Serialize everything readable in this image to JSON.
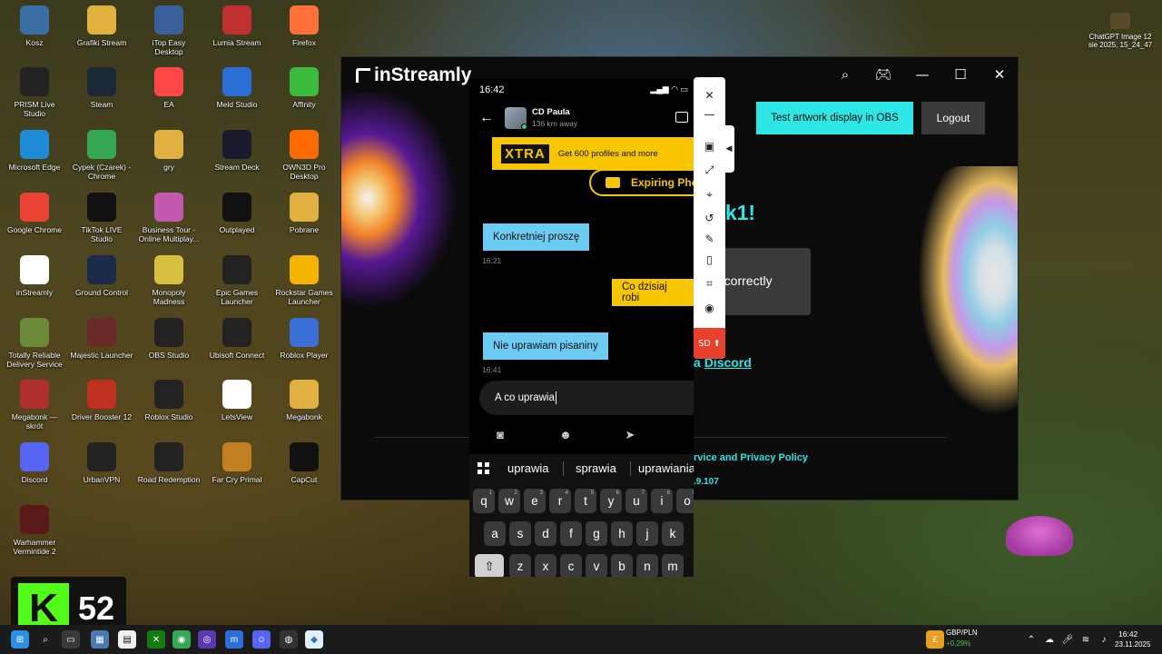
{
  "desktop_icons": [
    {
      "label": "Kosz",
      "icon": "recycle-bin-icon",
      "color": "#3a6ea5"
    },
    {
      "label": "Grafiki Stream",
      "icon": "folder-icon",
      "color": "#e0b040"
    },
    {
      "label": "iTop Easy Desktop",
      "icon": "grid-icon",
      "color": "#3a5f9a"
    },
    {
      "label": "Lumia Stream",
      "icon": "lumia-icon",
      "color": "#c03030"
    },
    {
      "label": "Firefox",
      "icon": "firefox-icon",
      "color": "#ff7139"
    },
    {
      "label": "PRISM Live Studio",
      "icon": "prism-icon",
      "color": "#222222"
    },
    {
      "label": "Steam",
      "icon": "steam-icon",
      "color": "#1b2838"
    },
    {
      "label": "EA",
      "icon": "ea-icon",
      "color": "#ff4747"
    },
    {
      "label": "Meld Studio",
      "icon": "meld-icon",
      "color": "#2b6fd6"
    },
    {
      "label": "Affinity",
      "icon": "affinity-icon",
      "color": "#3dbb3d"
    },
    {
      "label": "Microsoft Edge",
      "icon": "edge-icon",
      "color": "#1f8ad6"
    },
    {
      "label": "Cypek (Czarek) - Chrome",
      "icon": "chrome-icon",
      "color": "#34a853"
    },
    {
      "label": "gry",
      "icon": "folder-icon",
      "color": "#e0b040"
    },
    {
      "label": "Stream Deck",
      "icon": "stream-deck-icon",
      "color": "#1a1a2e"
    },
    {
      "label": "OWN3D Pro Desktop",
      "icon": "own3d-icon",
      "color": "#ff6a00"
    },
    {
      "label": "Google Chrome",
      "icon": "chrome-icon",
      "color": "#ea4335"
    },
    {
      "label": "TikTok LIVE Studio",
      "icon": "tiktok-icon",
      "color": "#111111"
    },
    {
      "label": "Business Tour - Online Multiplay...",
      "icon": "game-icon",
      "color": "#c45ab0"
    },
    {
      "label": "Outplayed",
      "icon": "outplayed-icon",
      "color": "#111111"
    },
    {
      "label": "Pobrane",
      "icon": "folder-icon",
      "color": "#e0b040"
    },
    {
      "label": "inStreamly",
      "icon": "instreamly-icon",
      "color": "#ffffff"
    },
    {
      "label": "Ground Control",
      "icon": "ground-control-icon",
      "color": "#1a2a4a"
    },
    {
      "label": "Monopoly Madness",
      "icon": "game-icon",
      "color": "#d8c040"
    },
    {
      "label": "Epic Games Launcher",
      "icon": "epic-icon",
      "color": "#222222"
    },
    {
      "label": "Rockstar Games Launcher",
      "icon": "rockstar-icon",
      "color": "#f4b400"
    },
    {
      "label": "Totally Reliable Delivery Service",
      "icon": "game-icon",
      "color": "#6a8a3a"
    },
    {
      "label": "Majestic Launcher",
      "icon": "majestic-icon",
      "color": "#6a2a2a"
    },
    {
      "label": "OBS Studio",
      "icon": "obs-icon",
      "color": "#222222"
    },
    {
      "label": "Ubisoft Connect",
      "icon": "ubisoft-icon",
      "color": "#222222"
    },
    {
      "label": "Roblox Player",
      "icon": "roblox-icon",
      "color": "#3a6fd8"
    },
    {
      "label": "Megabonk — skrót",
      "icon": "megabonk-icon",
      "color": "#b03030"
    },
    {
      "label": "Driver Booster 12",
      "icon": "driver-booster-icon",
      "color": "#c03020"
    },
    {
      "label": "Roblox Studio",
      "icon": "roblox-icon",
      "color": "#222222"
    },
    {
      "label": "LetsView",
      "icon": "letsview-icon",
      "color": "#ffffff"
    },
    {
      "label": "Megabonk",
      "icon": "folder-icon",
      "color": "#e0b040"
    },
    {
      "label": "Discord",
      "icon": "discord-icon",
      "color": "#5865f2"
    },
    {
      "label": "UrbanVPN",
      "icon": "vpn-icon",
      "color": "#222222"
    },
    {
      "label": "Road Redemption",
      "icon": "game-icon",
      "color": "#222222"
    },
    {
      "label": "Far Cry Primal",
      "icon": "game-icon",
      "color": "#c08020"
    },
    {
      "label": "CapCut",
      "icon": "capcut-icon",
      "color": "#111111"
    },
    {
      "label": "Warhammer Vermintide 2",
      "icon": "warhammer-icon",
      "color": "#5a1a1a"
    }
  ],
  "top_right_file": {
    "label": "ChatGPT Image 12 sie 2025, 15_24_47"
  },
  "window": {
    "title": "inStreamly",
    "test_button": "Test artwork display in OBS",
    "logout_button": "Logout",
    "greeting_fragment": "pek1!",
    "status_fragment": "g correctly",
    "discord_prefix": "a ",
    "discord_link": "Discord",
    "terms_fragment": "rvice and Privacy Policy",
    "version_fragment": ".9.107",
    "accent": "#2de6e6"
  },
  "phone": {
    "time": "16:42",
    "status_icons": "▂▄▆ ◠ ▭",
    "contact_name": "CD Paula",
    "contact_distance": "136 km away",
    "xtra_logo": "XTRA",
    "xtra_text": "Get 600 profiles and more",
    "expiring_text": "Expiring Phot",
    "messages": [
      {
        "dir": "in",
        "text": "Konkretniej proszę",
        "time": "16:21"
      },
      {
        "dir": "out",
        "text": "Co dzisiaj robi"
      },
      {
        "dir": "in",
        "text": "Nie uprawiam pisaniny",
        "time": "16:41"
      }
    ],
    "input_value": "A co uprawia",
    "suggestions": [
      "uprawia",
      "sprawia",
      "uprawiania"
    ],
    "keyboard_row1": [
      "q",
      "w",
      "e",
      "r",
      "t",
      "y",
      "u",
      "i",
      "o"
    ],
    "keyboard_row1_nums": [
      "1",
      "2",
      "3",
      "4",
      "5",
      "6",
      "7",
      "8",
      "9"
    ],
    "keyboard_row2": [
      "a",
      "s",
      "d",
      "f",
      "g",
      "h",
      "j",
      "k"
    ],
    "keyboard_row3": [
      "z",
      "x",
      "c",
      "v",
      "b",
      "n",
      "m"
    ]
  },
  "sidebar": {
    "sd_label": "SD"
  },
  "corner_widget": {
    "number": "52"
  },
  "taskbar": {
    "currency_pair": "GBP/PLN",
    "currency_change": "+0,29%",
    "time": "16:42",
    "date": "23.11.2025"
  }
}
